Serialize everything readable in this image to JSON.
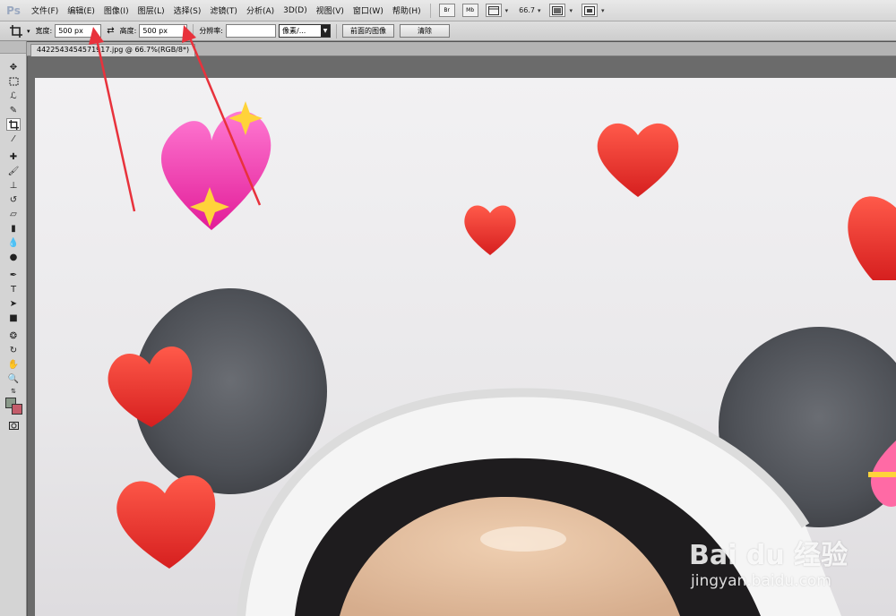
{
  "app": {
    "logo": "Ps"
  },
  "menu": [
    "文件(F)",
    "编辑(E)",
    "图像(I)",
    "图层(L)",
    "选择(S)",
    "滤镜(T)",
    "分析(A)",
    "3D(D)",
    "视图(V)",
    "窗口(W)",
    "帮助(H)"
  ],
  "menubar_controls": {
    "btn1": "Br",
    "btn2": "Mb",
    "zoom": "66.7",
    "caret": "▾"
  },
  "options": {
    "width_label": "宽度:",
    "width_value": "500 px",
    "height_label": "高度:",
    "height_value": "500 px",
    "resolution_label": "分辨率:",
    "resolution_value": "",
    "unit_select": "像素/...",
    "front_image_button": "前面的图像",
    "clear_button": "清除"
  },
  "document": {
    "tab_title": "4422543454571917.jpg @ 66.7%(RGB/8*)"
  },
  "watermark": {
    "logo": "Bai du 经验",
    "url": "jingyan.baidu.com"
  },
  "colors": {
    "accent_arrow": "#e8323c",
    "foreground_swatch": "#8a9a8a",
    "background_swatch": "#c45c6a"
  },
  "icons": [
    "crop-tool-icon",
    "move-tool-icon",
    "marquee-tool-icon",
    "lasso-tool-icon",
    "quick-select-icon",
    "crop-icon",
    "eyedropper-icon",
    "healing-brush-icon",
    "brush-icon",
    "clone-stamp-icon",
    "history-brush-icon",
    "eraser-icon",
    "gradient-icon",
    "blur-icon",
    "dodge-icon",
    "pen-icon",
    "type-icon",
    "path-select-icon",
    "shape-icon",
    "3d-rotate-icon",
    "3d-orbit-icon",
    "hand-icon",
    "zoom-icon",
    "swap-colors-icon",
    "quick-mask-icon"
  ]
}
